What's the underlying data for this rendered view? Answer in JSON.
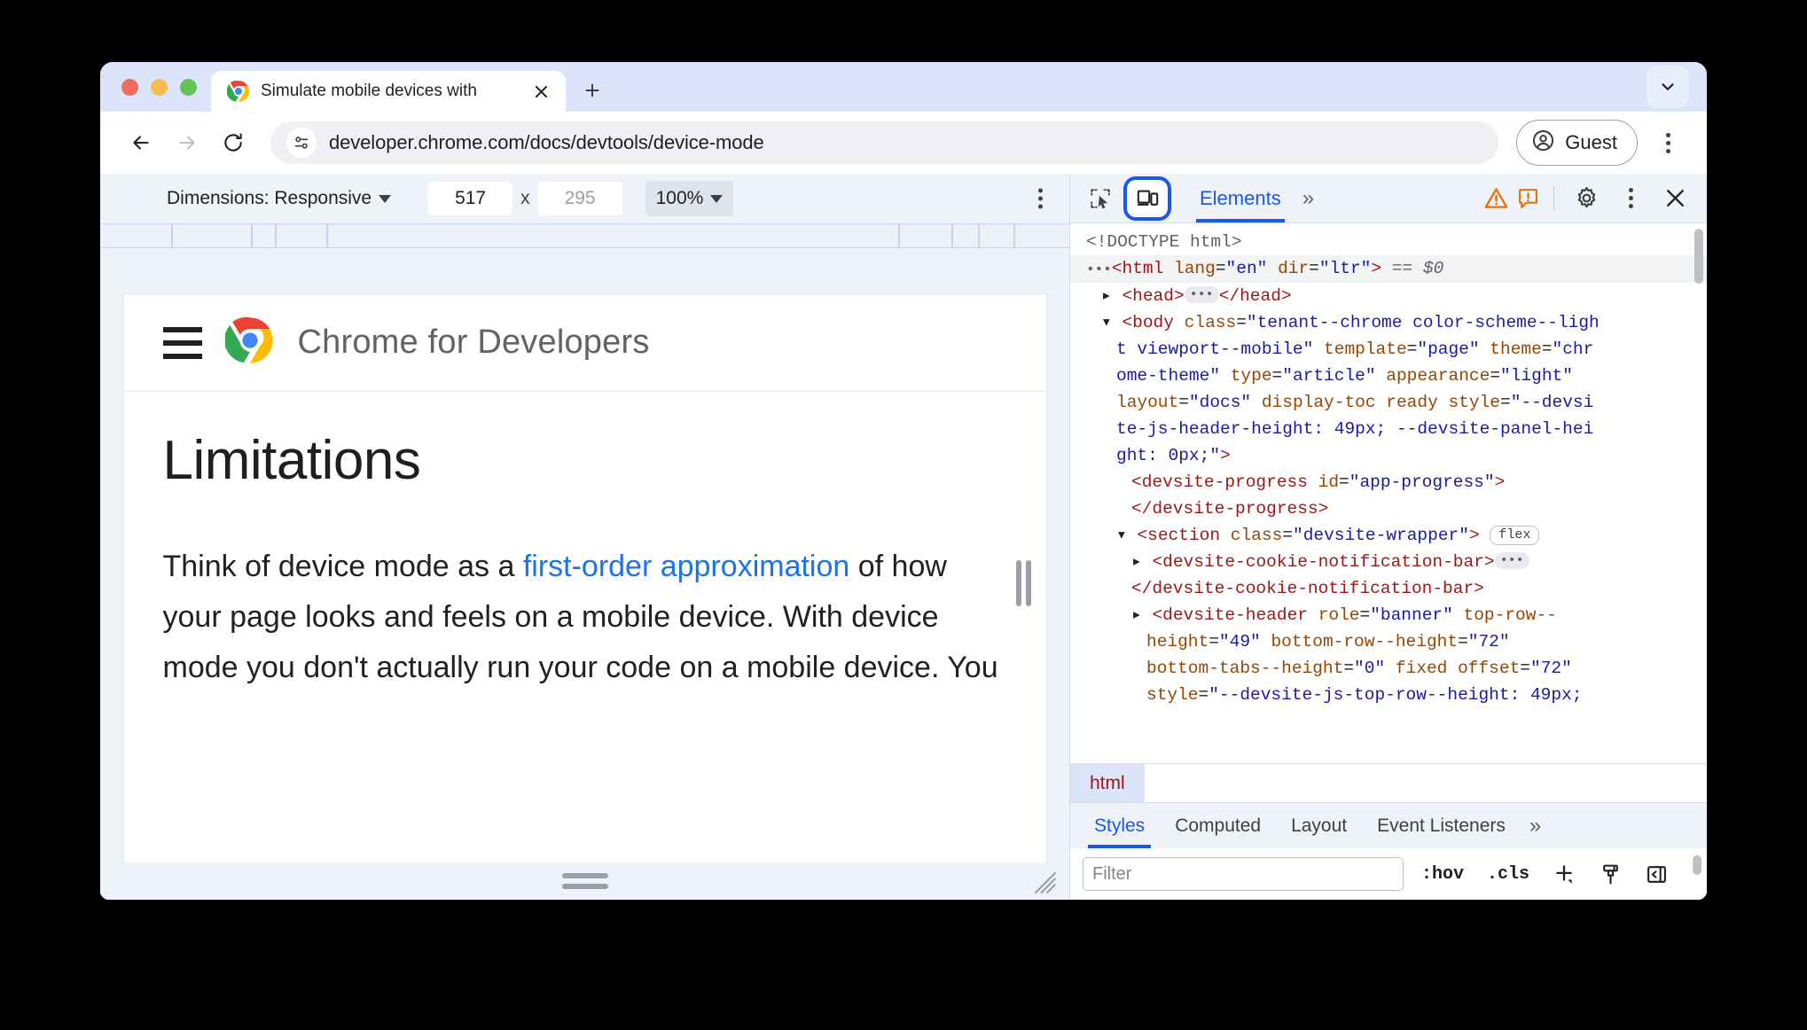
{
  "window": {
    "tab": {
      "title": "Simulate mobile devices with",
      "favicon": "chrome-logo-icon",
      "close_icon": "close-icon"
    },
    "new_tab_icon": "plus-icon",
    "tab_list_chevron_icon": "chevron-down-icon"
  },
  "toolbar": {
    "back_icon": "back-arrow-icon",
    "forward_icon": "forward-arrow-icon",
    "reload_icon": "reload-icon",
    "site_info_icon": "tune-settings-icon",
    "url": "developer.chrome.com/docs/devtools/device-mode",
    "profile_label": "Guest",
    "profile_icon": "account-circle-icon",
    "menu_icon": "three-dots-vertical-icon"
  },
  "device_toolbar": {
    "dimensions_label": "Dimensions: Responsive",
    "dimensions_caret_icon": "caret-down-icon",
    "width_value": "517",
    "separator": "x",
    "height_value": "295",
    "zoom_value": "100%",
    "zoom_caret_icon": "caret-down-icon",
    "more_options_icon": "three-dots-vertical-icon",
    "ruler_ticks": [
      80,
      170,
      197,
      255,
      900,
      960,
      990,
      1030
    ]
  },
  "viewport": {
    "menu_icon": "hamburger-menu-icon",
    "brand_icon": "chrome-logo-icon",
    "brand": "Chrome for Developers",
    "heading": "Limitations",
    "paragraph_before_link": "Think of device mode as a ",
    "paragraph_link": "first-order approximation",
    "paragraph_after_link": " of how your page looks and feels on a mobile device. With device mode you don't actually run your code on a mobile device. You",
    "right_handle_icon": "resize-handle-icon",
    "bottom_handle_icon": "resize-handle-icon",
    "corner_handle_icon": "resize-corner-icon"
  },
  "devtools": {
    "inspect_icon": "inspect-element-icon",
    "device_toggle_icon": "device-toolbar-icon",
    "device_toggle_active_color": "#1a56f0",
    "active_tab": "Elements",
    "more_tabs_icon": "chevron-double-right-icon",
    "warning_icon": "warning-triangle-icon",
    "issues_icon": "issue-exclamation-icon",
    "settings_icon": "gear-icon",
    "menu_icon": "three-dots-vertical-icon",
    "close_icon": "close-icon",
    "dom_lines": [
      {
        "indent": 0,
        "html": "<span class=\"tk-txt\">&lt;!DOCTYPE html&gt;</span>",
        "selected": false
      },
      {
        "indent": 0,
        "html": "<span class=\"tw\">•••</span><span class=\"tk-tag\">&lt;html</span> <span class=\"tk-attr\">lang</span>=<span class=\"tk-val\">\"en\"</span> <span class=\"tk-attr\">dir</span>=<span class=\"tk-val\">\"ltr\"</span><span class=\"tk-tag\">&gt;</span> <span class=\"tk-dollar\">== $0</span>",
        "selected": true
      },
      {
        "indent": 1,
        "html": "▸ <span class=\"tk-tag\">&lt;head&gt;</span><span class=\"badge-dots\">•••</span><span class=\"tk-tag\">&lt;/head&gt;</span>",
        "selected": false
      },
      {
        "indent": 1,
        "html": "▾ <span class=\"tk-tag\">&lt;body</span> <span class=\"tk-attr\">class</span>=<span class=\"tk-val\">\"tenant--chrome color-scheme--ligh</span>",
        "selected": false
      },
      {
        "indent": 2,
        "html": "<span class=\"tk-val\">t viewport--mobile\"</span> <span class=\"tk-attr\">template</span>=<span class=\"tk-val\">\"page\"</span> <span class=\"tk-attr\">theme</span>=<span class=\"tk-val\">\"chr</span>",
        "selected": false
      },
      {
        "indent": 2,
        "html": "<span class=\"tk-val\">ome-theme\"</span> <span class=\"tk-attr\">type</span>=<span class=\"tk-val\">\"article\"</span> <span class=\"tk-attr\">appearance</span>=<span class=\"tk-val\">\"light\"</span>",
        "selected": false
      },
      {
        "indent": 2,
        "html": "<span class=\"tk-attr\">layout</span>=<span class=\"tk-val\">\"docs\"</span> <span class=\"tk-attr\">display-toc ready</span> <span class=\"tk-attr\">style</span>=<span class=\"tk-val\">\"--devsi</span>",
        "selected": false
      },
      {
        "indent": 2,
        "html": "<span class=\"tk-val\">te-js-header-height: 49px; --devsite-panel-hei</span>",
        "selected": false
      },
      {
        "indent": 2,
        "html": "<span class=\"tk-val\">ght: 0px;\"</span><span class=\"tk-tag\">&gt;</span>",
        "selected": false
      },
      {
        "indent": 3,
        "html": "<span class=\"tk-tag\">&lt;devsite-progress</span> <span class=\"tk-attr\">id</span>=<span class=\"tk-val\">\"app-progress\"</span><span class=\"tk-tag\">&gt;</span>",
        "selected": false
      },
      {
        "indent": 3,
        "html": "<span class=\"tk-tag\">&lt;/devsite-progress&gt;</span>",
        "selected": false
      },
      {
        "indent": 2,
        "html": "▾ <span class=\"tk-tag\">&lt;section</span> <span class=\"tk-attr\">class</span>=<span class=\"tk-val\">\"devsite-wrapper\"</span><span class=\"tk-tag\">&gt;</span> <span class=\"badge-flex\">flex</span>",
        "selected": false
      },
      {
        "indent": 3,
        "html": "▸ <span class=\"tk-tag\">&lt;devsite-cookie-notification-bar&gt;</span><span class=\"badge-dots\">•••</span>",
        "selected": false
      },
      {
        "indent": 3,
        "html": "<span class=\"tk-tag\">&lt;/devsite-cookie-notification-bar&gt;</span>",
        "selected": false
      },
      {
        "indent": 3,
        "html": "▸ <span class=\"tk-tag\">&lt;devsite-header</span> <span class=\"tk-attr\">role</span>=<span class=\"tk-val\">\"banner\"</span> <span class=\"tk-attr\">top-row--</span>",
        "selected": false
      },
      {
        "indent": 4,
        "html": "<span class=\"tk-attr\">height</span>=<span class=\"tk-val\">\"49\"</span> <span class=\"tk-attr\">bottom-row--height</span>=<span class=\"tk-val\">\"72\"</span>",
        "selected": false
      },
      {
        "indent": 4,
        "html": "<span class=\"tk-attr\">bottom-tabs--height</span>=<span class=\"tk-val\">\"0\"</span> <span class=\"tk-attr\">fixed offset</span>=<span class=\"tk-val\">\"72\"</span>",
        "selected": false
      },
      {
        "indent": 4,
        "html": "<span class=\"tk-attr\">style</span>=<span class=\"tk-val\">\"--devsite-js-top-row--height: 49px;</span>",
        "selected": false
      }
    ],
    "breadcrumb": [
      "html"
    ],
    "styles_tabs": [
      {
        "label": "Styles",
        "active": true
      },
      {
        "label": "Computed",
        "active": false
      },
      {
        "label": "Layout",
        "active": false
      },
      {
        "label": "Event Listeners",
        "active": false
      }
    ],
    "styles_more_icon": "chevron-double-right-icon",
    "filter_placeholder": "Filter",
    "filter_value": "",
    "hov_label": ":hov",
    "cls_label": ".cls",
    "new_style_rule_icon": "plus-icon",
    "element_classes_icon": "paintbrush-icon",
    "computed_sidebar_icon": "sidebar-toggle-icon"
  }
}
